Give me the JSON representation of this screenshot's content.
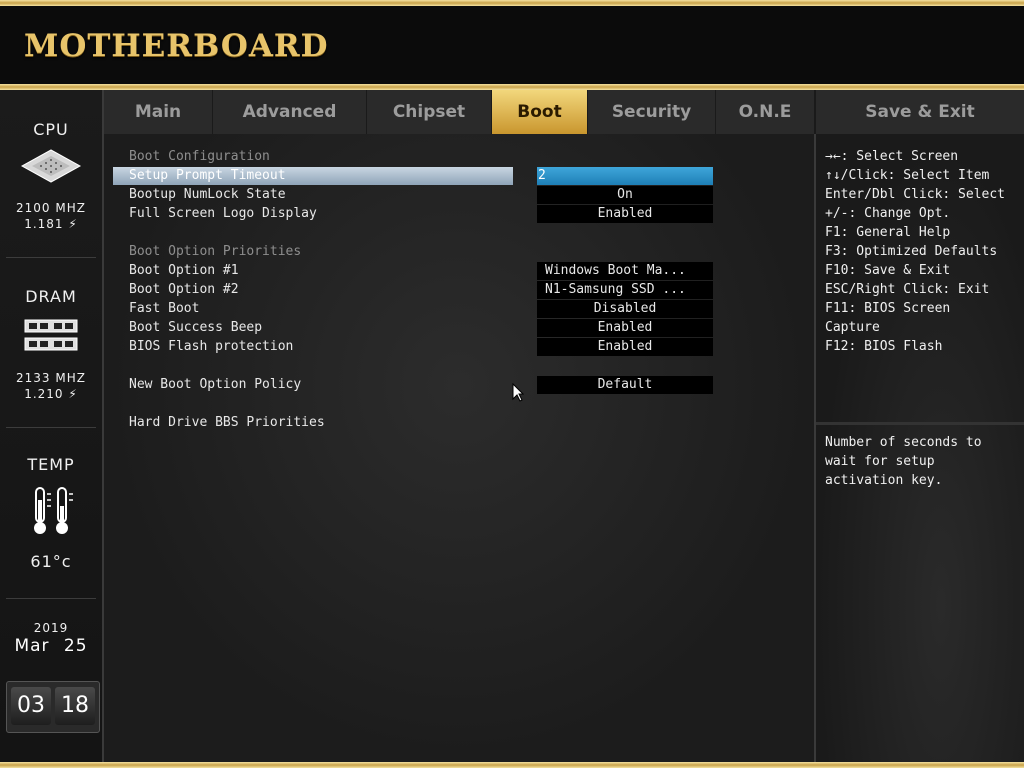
{
  "header": {
    "logo": "MOTHERBOARD"
  },
  "sidebar": {
    "cpu": {
      "title": "CPU",
      "freq": "2100 MHZ",
      "volt": "1.181 ⚡"
    },
    "dram": {
      "title": "DRAM",
      "freq": "2133 MHZ",
      "volt": "1.210 ⚡"
    },
    "temp": {
      "title": "TEMP",
      "value": "61°c"
    },
    "date": {
      "year": "2019",
      "month": "Mar",
      "day": "25"
    },
    "clock": {
      "hours": "03",
      "minutes": "18"
    }
  },
  "tabs": [
    {
      "label": "Main"
    },
    {
      "label": "Advanced"
    },
    {
      "label": "Chipset"
    },
    {
      "label": "Boot",
      "active": true
    },
    {
      "label": "Security"
    },
    {
      "label": "O.N.E"
    }
  ],
  "save_tab": "Save & Exit",
  "main": {
    "boot_config_header": "Boot Configuration",
    "setup_prompt_label": "Setup Prompt Timeout",
    "setup_prompt_value": "2",
    "numlock_label": "Bootup NumLock State",
    "numlock_value": "On",
    "logo_label": "Full Screen Logo Display",
    "logo_value": "Enabled",
    "priorities_header": "Boot Option Priorities",
    "boot1_label": "Boot Option #1",
    "boot1_value": "Windows Boot Ma...",
    "boot2_label": "Boot Option #2",
    "boot2_value": "N1-Samsung SSD ...",
    "fastboot_label": "Fast Boot",
    "fastboot_value": "Disabled",
    "beep_label": "Boot Success Beep",
    "beep_value": "Enabled",
    "flash_label": "BIOS Flash protection",
    "flash_value": "Enabled",
    "policy_label": "New Boot Option Policy",
    "policy_value": "Default",
    "hdd_label": "Hard Drive BBS Priorities"
  },
  "help": {
    "keys": [
      "→←: Select Screen",
      "↑↓/Click: Select Item",
      "Enter/Dbl Click: Select",
      "+/-: Change Opt.",
      "F1: General Help",
      "F3: Optimized Defaults",
      "F10: Save & Exit",
      "ESC/Right Click: Exit",
      "F11: BIOS Screen",
      "Capture",
      "F12: BIOS Flash"
    ],
    "description": "Number of seconds to\nwait for setup\nactivation key."
  },
  "colors": {
    "gold": "#e8c46a",
    "selected_value": "#1e7fb6",
    "highlight_row": "#8fa4b8"
  }
}
